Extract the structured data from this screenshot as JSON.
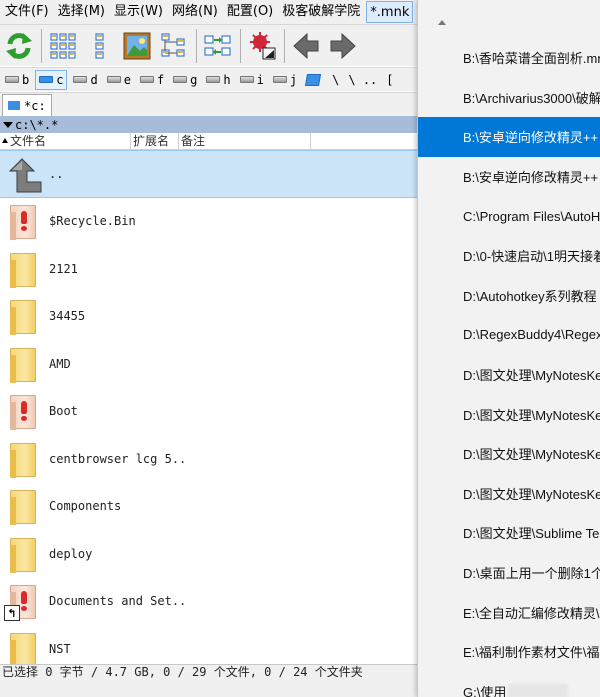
{
  "menubar": {
    "items": [
      "文件(F)",
      "选择(M)",
      "显示(W)",
      "网络(N)",
      "配置(O)",
      "极客破解学院",
      "*.mnk"
    ]
  },
  "toolbar": {
    "buttons": [
      "refresh-icon",
      "grid-view-icon",
      "list-view-icon",
      "image-view-icon",
      "tree-view-icon",
      "sync-dirs-icon",
      "splat-config-icon",
      "back-arrow-icon",
      "forward-arrow-icon"
    ]
  },
  "drivebar": {
    "drives": [
      "b",
      "c",
      "d",
      "e",
      "f",
      "g",
      "h",
      "i",
      "j",
      "\\",
      "..",
      "["
    ],
    "active": "c"
  },
  "tab": {
    "label": "*c:"
  },
  "path": {
    "text": "c:\\*.*"
  },
  "columns": {
    "name": "文件名",
    "ext": "扩展名",
    "note": "备注"
  },
  "files": [
    {
      "name": "..",
      "type": "up"
    },
    {
      "name": "$Recycle.Bin",
      "type": "sys"
    },
    {
      "name": "2121",
      "type": "folder"
    },
    {
      "name": "34455",
      "type": "folder"
    },
    {
      "name": "AMD",
      "type": "folder"
    },
    {
      "name": "Boot",
      "type": "sys"
    },
    {
      "name": "centbrowser lcg 5..",
      "type": "folder"
    },
    {
      "name": "Components",
      "type": "folder"
    },
    {
      "name": "deploy",
      "type": "folder"
    },
    {
      "name": "Documents and Set..",
      "type": "sys-link"
    },
    {
      "name": "NST",
      "type": "folder"
    }
  ],
  "status": {
    "text": "已选择 0 字节 / 4.7 GB, 0 / 29 个文件, 0 / 24 个文件夹"
  },
  "popup": {
    "items": [
      "B:\\香哈菜谱全面剖析.mnk",
      "B:\\Archivarius3000\\破解",
      "B:\\安卓逆向修改精灵++",
      "B:\\安卓逆向修改精灵++",
      "C:\\Program Files\\AutoH",
      "D:\\0-快速启动\\1明天接着",
      "D:\\Autohotkey系列教程",
      "D:\\RegexBuddy4\\Regex",
      "D:\\图文处理\\MyNotesKe",
      "D:\\图文处理\\MyNotesKe",
      "D:\\图文处理\\MyNotesKe",
      "D:\\图文处理\\MyNotesKe",
      "D:\\图文处理\\Sublime Te",
      "D:\\桌面上用一个删除1个",
      "E:\\全自动汇编修改精灵\\",
      "E:\\福利制作素材文件\\福利",
      "G:\\使用"
    ],
    "selected_index": 2
  }
}
